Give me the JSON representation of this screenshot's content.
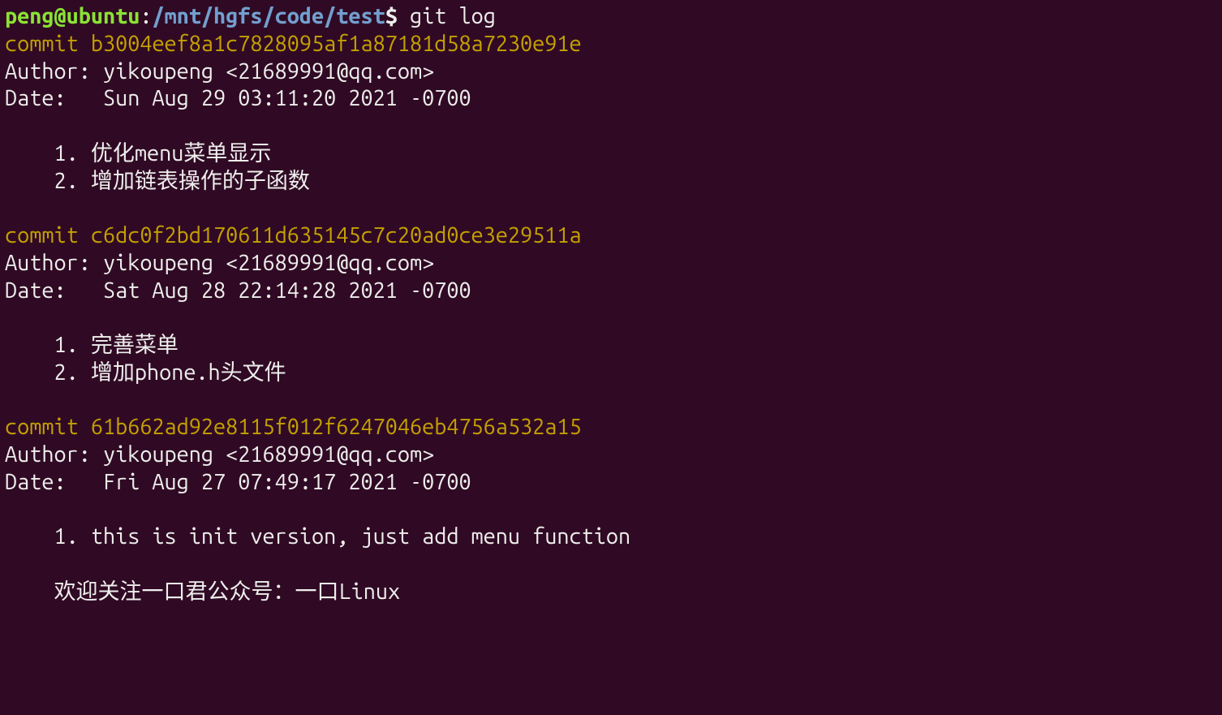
{
  "prompt": {
    "user": "peng@ubuntu",
    "sep1": ":",
    "path": "/mnt/hgfs/code/test",
    "dollar": "$ ",
    "command": "git log"
  },
  "commits": [
    {
      "commit_line": "commit b3004eef8a1c7828095af1a87181d58a7230e91e",
      "author_line": "Author: yikoupeng <21689991@qq.com>",
      "date_line": "Date:   Sun Aug 29 03:11:20 2021 -0700",
      "messages": [
        "    1. 优化menu菜单显示",
        "    2. 增加链表操作的子函数"
      ]
    },
    {
      "commit_line": "commit c6dc0f2bd170611d635145c7c20ad0ce3e29511a",
      "author_line": "Author: yikoupeng <21689991@qq.com>",
      "date_line": "Date:   Sat Aug 28 22:14:28 2021 -0700",
      "messages": [
        "    1. 完善菜单",
        "    2. 增加phone.h头文件"
      ]
    },
    {
      "commit_line": "commit 61b662ad92e8115f012f6247046eb4756a532a15",
      "author_line": "Author: yikoupeng <21689991@qq.com>",
      "date_line": "Date:   Fri Aug 27 07:49:17 2021 -0700",
      "messages": [
        "    1. this is init version, just add menu function",
        "",
        "    欢迎关注一口君公众号：一口Linux"
      ]
    }
  ]
}
